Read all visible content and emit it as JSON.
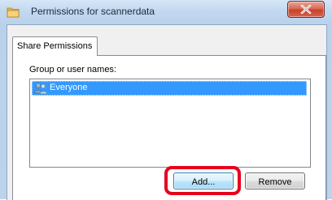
{
  "window": {
    "title": "Permissions for scannerdata",
    "title_icon": "folder-icon",
    "close_icon": "close-x-icon"
  },
  "tabs": [
    {
      "label": "Share Permissions",
      "active": true
    }
  ],
  "permissions": {
    "group_label": "Group or user names:",
    "users": [
      {
        "name": "Everyone",
        "icon": "users-group-icon",
        "selected": true
      }
    ],
    "add_label": "Add...",
    "remove_label": "Remove"
  },
  "colors": {
    "selection": "#3399ff",
    "highlight_annotation": "#e8001c",
    "close_button": "#c7412a"
  }
}
